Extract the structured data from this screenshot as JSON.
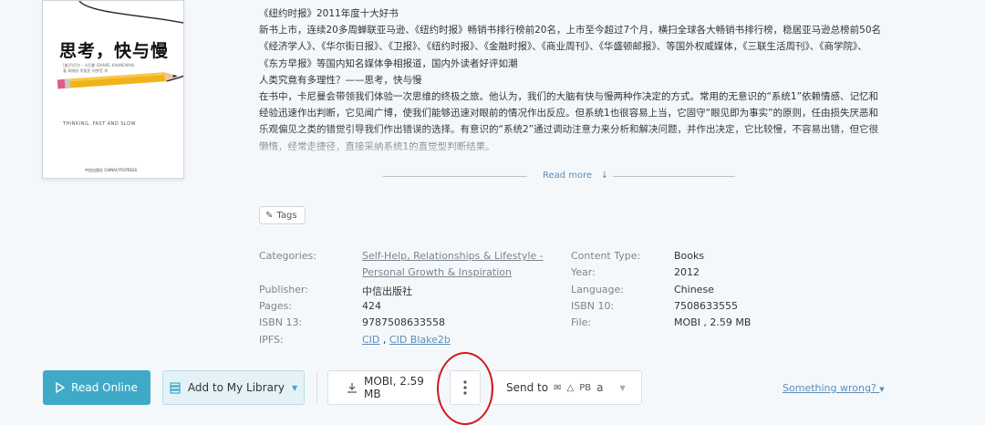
{
  "book": {
    "cover": {
      "title": "思考，快与慢",
      "subtitle_en": "THINKING, FAST AND SLOW",
      "author_line": "[美]丹尼尔・卡尼曼 (DANIEL KAHNEMAN) 著 胡晓姣 李爱民 何梦莹 译",
      "publisher_logo": "中信出版社 CHINACITICPRESS"
    },
    "description": [
      "《纽约时报》2011年度十大好书",
      "新书上市，连续20多周蝉联亚马逊、《纽约时报》畅销书排行榜前20名，上市至今超过7个月，横扫全球各大畅销书排行榜，稳居亚马逊总榜前50名",
      "《经济学人》、《华尔街日报》、《卫报》、《纽约时报》、《金融时报》、《商业周刊》、《华盛顿邮报》、等国外权威媒体，《三联生活周刊》、《商学院》、《东方早报》等国内知名媒体争相报道，国内外读者好评如潮",
      "人类究竟有多理性？——思考，快与慢",
      "在书中，卡尼曼会带领我们体验一次思维的终极之旅。他认为，我们的大脑有快与慢两种作决定的方式。常用的无意识的“系统1”依赖情感、记忆和经验迅速作出判断，它见闻广博，使我们能够迅速对眼前的情况作出反应。但系统1也很容易上当，它固守“眼见即为事实”的原则，任由损失厌恶和乐观偏见之类的错觉引导我们作出错误的选择。有意识的“系统2”通过调动注意力来分析和解决问题，并作出决定，它比较慢，不容易出错，但它很懒惰，经常走捷径，直接采纳系统1的直觉型判断结果。"
    ],
    "read_more": "Read more",
    "tags_label": "Tags",
    "labels": {
      "categories": "Categories:",
      "publisher": "Publisher:",
      "pages": "Pages:",
      "isbn13": "ISBN 13:",
      "ipfs": "IPFS:",
      "content_type": "Content Type:",
      "year": "Year:",
      "language": "Language:",
      "isbn10": "ISBN 10:",
      "file": "File:"
    },
    "values": {
      "categories_line1": "Self-Help, Relationships & Lifestyle -",
      "categories_line2": "Personal Growth & Inspiration",
      "publisher": "中信出版社",
      "pages": "424",
      "isbn13": "9787508633558",
      "ipfs_cid": "CID",
      "ipfs_sep": " , ",
      "ipfs_blake": "CID Blake2b",
      "content_type": "Books",
      "year": "2012",
      "language": "Chinese",
      "isbn10": "7508633555",
      "file": "MOBI , 2.59 MB"
    }
  },
  "actions": {
    "read_online": "Read Online",
    "add_to_library": "Add to My Library",
    "download": "MOBI, 2.59 MB",
    "send_to": "Send to",
    "send_to_pb": "PB",
    "something_wrong": "Something wrong?"
  },
  "colors": {
    "accent": "#3faac7",
    "link": "#5b8db8",
    "annotation_circle": "#d11a1a"
  }
}
